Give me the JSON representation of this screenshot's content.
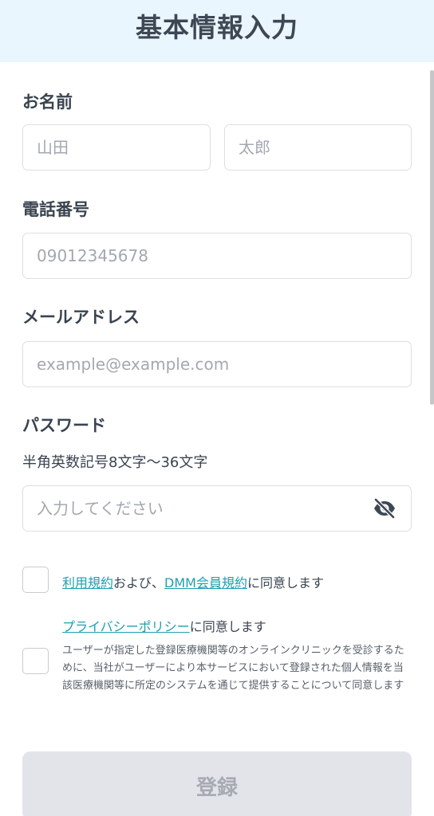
{
  "header": {
    "title": "基本情報入力"
  },
  "name": {
    "label": "お名前",
    "last_placeholder": "山田",
    "first_placeholder": "太郎"
  },
  "phone": {
    "label": "電話番号",
    "placeholder": "09012345678"
  },
  "email": {
    "label": "メールアドレス",
    "placeholder": "example@example.com"
  },
  "password": {
    "label": "パスワード",
    "hint": "半角英数記号8文字〜36文字",
    "placeholder": "入力してください",
    "toggle_icon": "eye-off-icon"
  },
  "agreements": {
    "terms_link": "利用規約",
    "terms_mid": "および、",
    "dmm_link": "DMM会員規約",
    "terms_suffix": "に同意します",
    "privacy_link": "プライバシーポリシー",
    "privacy_suffix": "に同意します",
    "privacy_note": "ユーザーが指定した登録医療機関等のオンラインクリニックを受診するために、当社がユーザーにより本サービスにおいて登録された個人情報を当該医療機関等に所定のシステムを通じて提供することについて同意します"
  },
  "submit": {
    "label": "登録"
  },
  "colors": {
    "header_bg": "#eaf6fd",
    "link": "#1f9fb0",
    "button_disabled_bg": "#e3e4ea"
  }
}
